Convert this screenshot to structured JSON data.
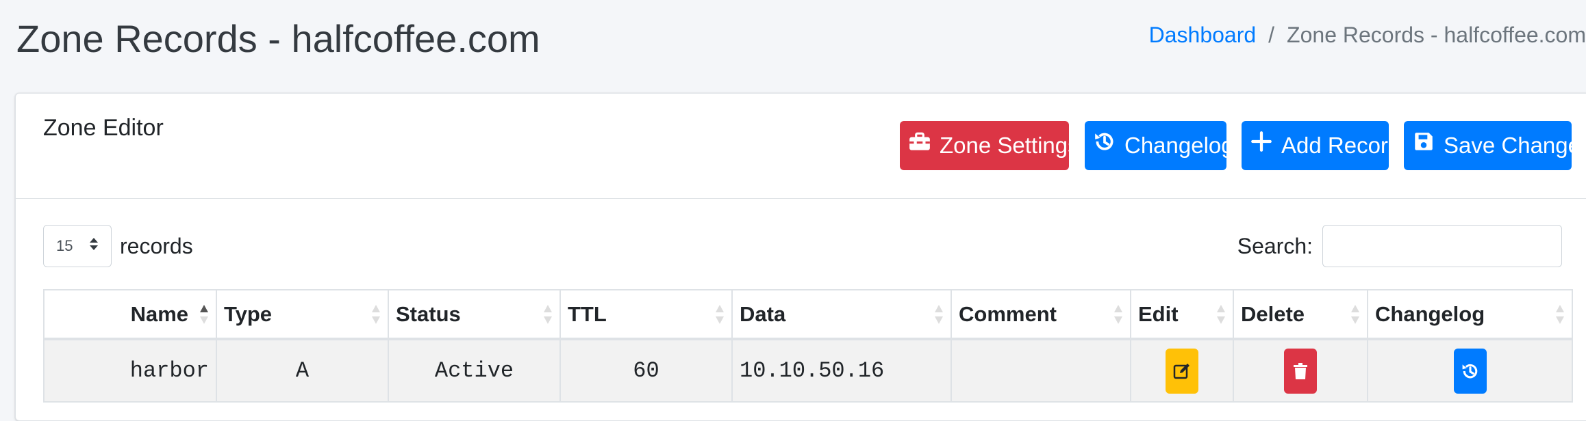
{
  "header": {
    "title": "Zone Records - halfcoffee.com",
    "breadcrumb": [
      {
        "label": "Dashboard"
      },
      {
        "label": "Zone Records - halfcoffee.com"
      }
    ]
  },
  "card": {
    "title": "Zone Editor",
    "buttons": {
      "zone_settings": "Zone Settings",
      "changelog": "Changelog",
      "add_record": "Add Record",
      "save_changes": "Save Changes"
    }
  },
  "table_controls": {
    "length_value": "15",
    "length_suffix": "records",
    "search_label": "Search:",
    "search_value": ""
  },
  "table": {
    "columns": [
      "Name",
      "Type",
      "Status",
      "TTL",
      "Data",
      "Comment",
      "Edit",
      "Delete",
      "Changelog"
    ],
    "rows": [
      {
        "name": "harbor",
        "type": "A",
        "status": "Active",
        "ttl": "60",
        "data": "10.10.50.16",
        "comment": ""
      }
    ]
  },
  "icons": {
    "zone_settings": "toolbox-icon",
    "changelog": "history-icon",
    "add_record": "plus-icon",
    "save_changes": "floppy-disk-icon",
    "edit": "edit-icon",
    "delete": "trash-icon",
    "row_changelog": "history-icon"
  },
  "colors": {
    "primary": "#007bff",
    "danger": "#dc3545",
    "warning": "#ffc107",
    "link": "#007bff"
  }
}
